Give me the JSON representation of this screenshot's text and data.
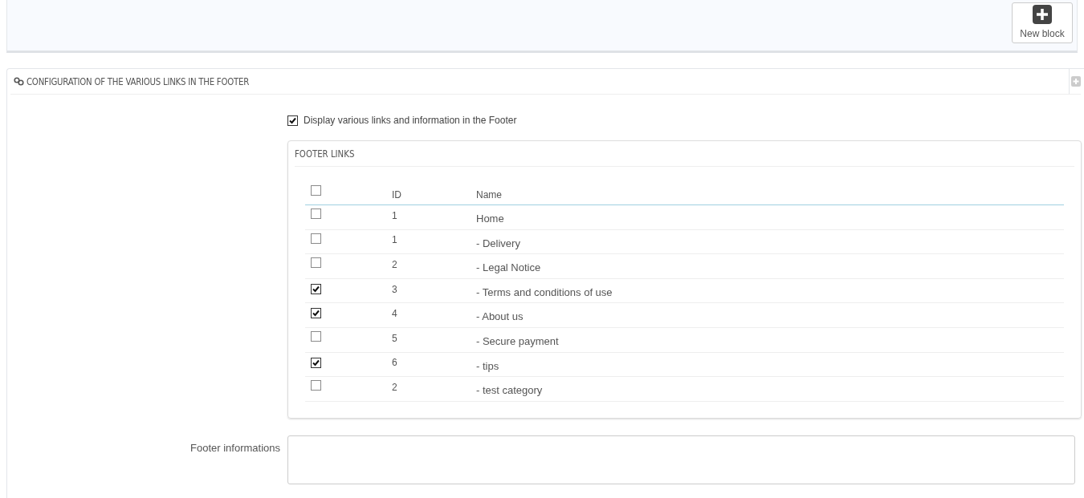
{
  "toolbar": {
    "new_button": {
      "label": "New block"
    }
  },
  "panel": {
    "title": "CONFIGURATION OF THE VARIOUS LINKS IN THE FOOTER",
    "display_option": {
      "label": "Display various links and information in the Footer",
      "checked": true
    },
    "footer_links": {
      "title": "FOOTER LINKS",
      "select_all": {
        "checked": false
      },
      "columns": [
        "ID",
        "Name"
      ],
      "rows": [
        {
          "checked": false,
          "id": "1",
          "name": "Home"
        },
        {
          "checked": false,
          "id": "1",
          "name": "- Delivery"
        },
        {
          "checked": false,
          "id": "2",
          "name": "- Legal Notice"
        },
        {
          "checked": true,
          "id": "3",
          "name": "- Terms and conditions of use"
        },
        {
          "checked": true,
          "id": "4",
          "name": "- About us"
        },
        {
          "checked": false,
          "id": "5",
          "name": "- Secure payment"
        },
        {
          "checked": true,
          "id": "6",
          "name": "- tips"
        },
        {
          "checked": false,
          "id": "2",
          "name": "- test category"
        }
      ]
    },
    "footer_info": {
      "label": "Footer informations"
    }
  }
}
